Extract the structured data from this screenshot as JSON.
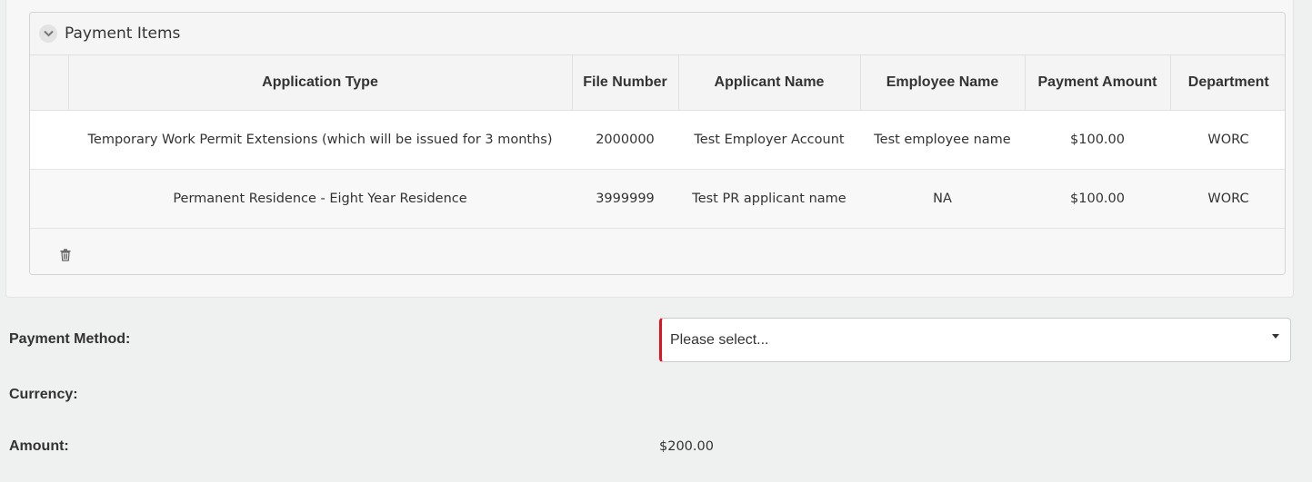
{
  "payment_items": {
    "title": "Payment Items",
    "columns": [
      "",
      "Application Type",
      "File Number",
      "Applicant Name",
      "Employee Name",
      "Payment Amount",
      "Department"
    ],
    "rows": [
      {
        "application_type": "Temporary Work Permit Extensions (which will be issued for 3 months)",
        "file_number": "2000000",
        "applicant_name": "Test Employer Account",
        "employee_name": "Test employee name",
        "payment_amount": "$100.00",
        "department": "WORC"
      },
      {
        "application_type": "Permanent Residence - Eight Year Residence",
        "file_number": "3999999",
        "applicant_name": "Test PR applicant name",
        "employee_name": "NA",
        "payment_amount": "$100.00",
        "department": "WORC"
      }
    ]
  },
  "form": {
    "payment_method_label": "Payment Method:",
    "payment_method_placeholder": "Please select...",
    "currency_label": "Currency:",
    "currency_value": "",
    "amount_label": "Amount:",
    "amount_value": "$200.00"
  },
  "icons": {
    "collapse": "chevron-down-icon",
    "delete": "trash-icon",
    "dropdown": "caret-down-icon"
  },
  "colors": {
    "required_indicator": "#e0131f"
  }
}
